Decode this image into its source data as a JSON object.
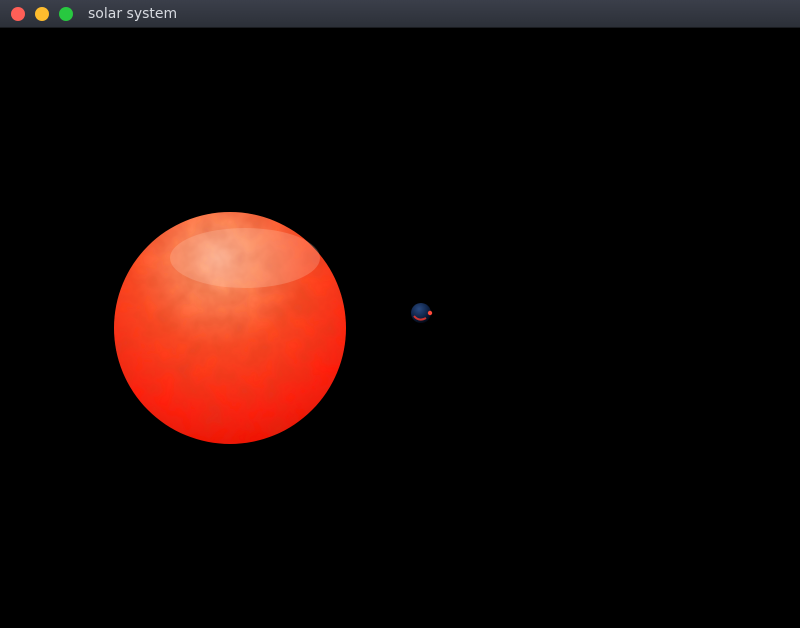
{
  "window": {
    "title": "solar system",
    "controls": [
      {
        "name": "close",
        "color": "#ff5f57"
      },
      {
        "name": "minimize",
        "color": "#febc2e"
      },
      {
        "name": "maximize",
        "color": "#28c840"
      }
    ]
  },
  "scene": {
    "background": "#000000",
    "bodies": [
      {
        "name": "sun",
        "colors": [
          "#ff2a10",
          "#ff6a3a",
          "#ffb08a"
        ]
      },
      {
        "name": "planet",
        "colors": [
          "#0a1a3a",
          "#1e3a6a",
          "#ff3b30"
        ]
      }
    ]
  }
}
